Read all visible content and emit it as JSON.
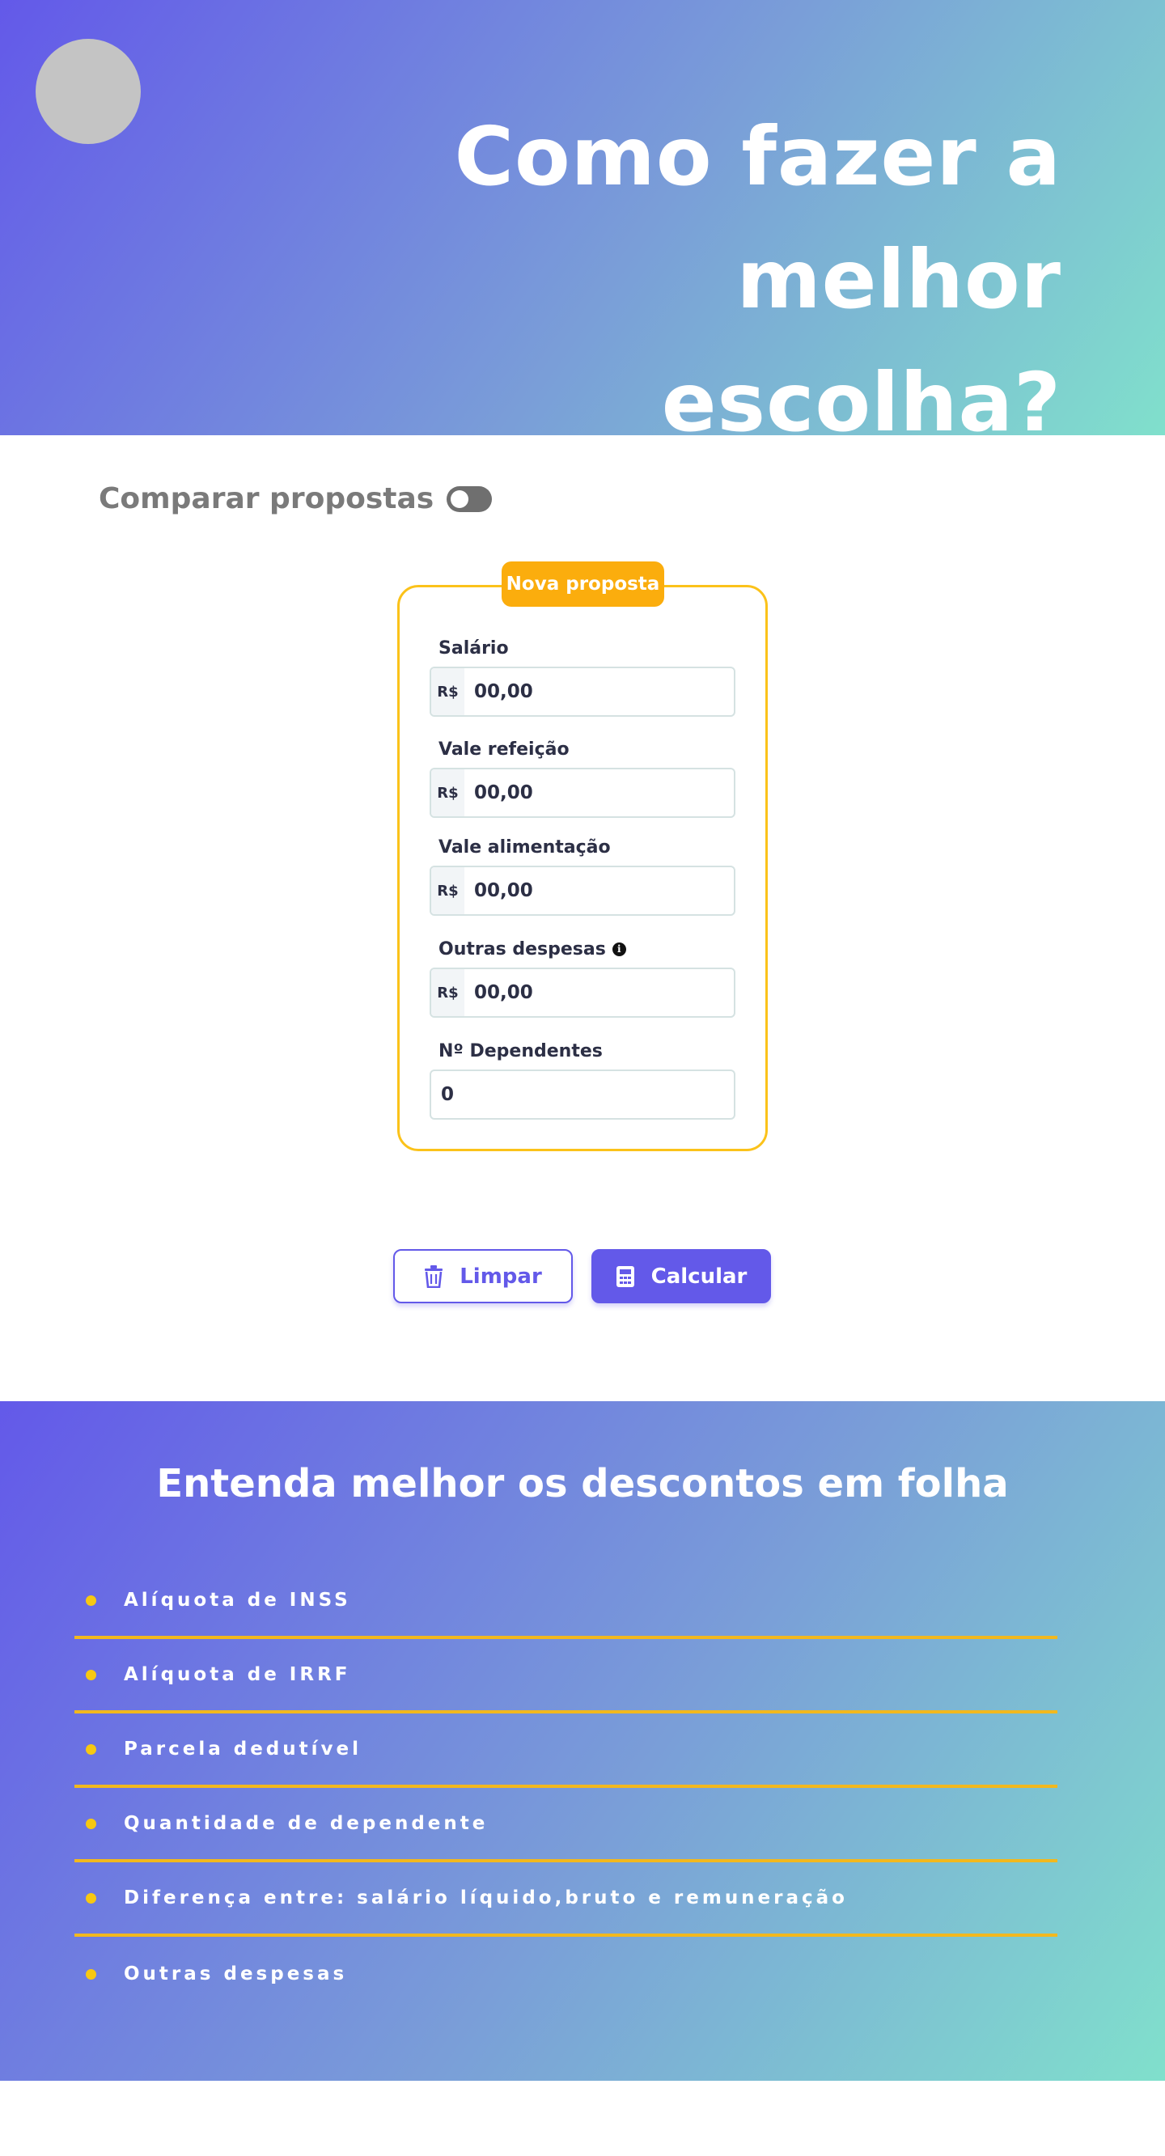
{
  "hero": {
    "title_line1": "Como fazer a",
    "title_line2": "melhor escolha?"
  },
  "compare": {
    "label": "Comparar propostas",
    "toggle_on": false
  },
  "proposal": {
    "badge": "Nova proposta",
    "currency_prefix": "R$",
    "fields": [
      {
        "label": "Salário",
        "placeholder": "00,00"
      },
      {
        "label": "Vale refeição",
        "placeholder": "00,00"
      },
      {
        "label": "Vale alimentação",
        "placeholder": "00,00"
      },
      {
        "label": "Outras despesas",
        "placeholder": "00,00"
      },
      {
        "label": "Nº Dependentes",
        "placeholder": "0"
      }
    ],
    "info_icon": "info-icon"
  },
  "actions": {
    "clear_label": "Limpar",
    "calc_label": "Calcular",
    "clear_icon": "trash-icon",
    "calc_icon": "calculator-icon"
  },
  "info_section": {
    "title": "Entenda melhor os descontos em folha",
    "topics": [
      "Alíquota de INSS",
      "Alíquota de IRRF",
      "Parcela dedutível",
      "Quantidade de dependente",
      "Diferença entre: salário líquido,bruto e remuneração",
      "Outras despesas"
    ]
  },
  "colors": {
    "brand": "#6359e9",
    "accent": "#fbad0d",
    "gradient_end": "#80e0cc"
  }
}
